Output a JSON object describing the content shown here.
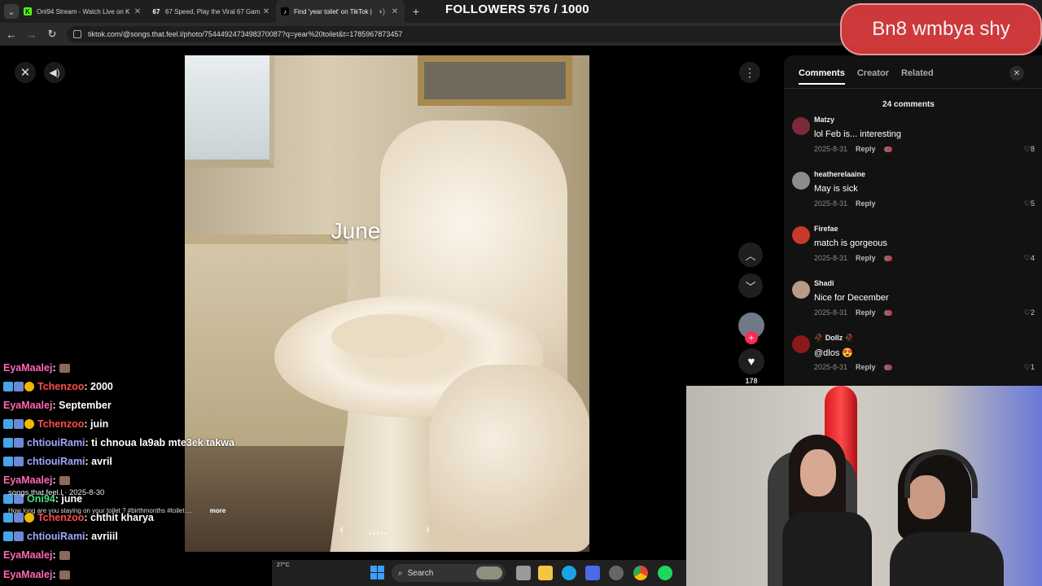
{
  "browser": {
    "tabs": [
      {
        "title": "Oni94 Stream - Watch Live on K",
        "favicon": "K",
        "active": false
      },
      {
        "title": "67 Speed, Play the Viral 67 Gam",
        "favicon": "67",
        "active": false
      },
      {
        "title": "Find 'year toilet' on TikTok |",
        "favicon": "♪",
        "active": true
      }
    ],
    "url": "tiktok.com/@songs.that.feel.l/photo/7544492473498370087?q=year%20toilet&t=1785967873457"
  },
  "overlay": {
    "followers": "FOLLOWERS 576 / 1000",
    "badge": "Bn8 wmbya shy"
  },
  "viewer": {
    "caption_word": "June",
    "like_count": "178",
    "author_line": "songs.that.feel.l · 2025-8-30",
    "description": "How long are you staying on your toilet ? #birthmonths #toilet ...",
    "more_label": "more"
  },
  "comments_panel": {
    "tabs": [
      "Comments",
      "Creator",
      "Related"
    ],
    "count_label": "24 comments",
    "reply_label": "Reply",
    "comments": [
      {
        "user": "Matzy",
        "text": "lol Feb is... interesting",
        "date": "2025-8-31",
        "likes": "8",
        "avatar_color": "#7a2a3a"
      },
      {
        "user": "heatherelaaine",
        "text": "May is sick",
        "date": "2025-8-31",
        "likes": "5",
        "avatar_color": "#8c8c8c"
      },
      {
        "user": "Firefae",
        "text": "match is gorgeous",
        "date": "2025-8-31",
        "likes": "4",
        "avatar_color": "#c83a2a"
      },
      {
        "user": "Shadi",
        "text": "Nice for December",
        "date": "2025-8-31",
        "likes": "2",
        "avatar_color": "#b89a86"
      },
      {
        "user": "🥀 Dollz 🥀",
        "text": "@dlos 😍",
        "date": "2025-8-31",
        "likes": "1",
        "avatar_color": "#8a1a1a"
      }
    ]
  },
  "chat": [
    {
      "user": "EyaMaalej",
      "color": "#ff69b4",
      "badges": 0,
      "msg": " : ",
      "emote": true
    },
    {
      "user": "Tchenzoo",
      "color": "#ff4d4d",
      "badges": 3,
      "msg": " : 2000",
      "emote": false
    },
    {
      "user": "EyaMaalej",
      "color": "#ff69b4",
      "badges": 0,
      "msg": " : September",
      "emote": false
    },
    {
      "user": "Tchenzoo",
      "color": "#ff4d4d",
      "badges": 3,
      "msg": " : juin",
      "emote": false
    },
    {
      "user": "chtiouiRami",
      "color": "#9fa8ff",
      "badges": 2,
      "msg": " : ti chnoua la9ab mte3ek takwa",
      "emote": false
    },
    {
      "user": "chtiouiRami",
      "color": "#9fa8ff",
      "badges": 2,
      "msg": " : avril",
      "emote": false
    },
    {
      "user": "EyaMaalej",
      "color": "#ff69b4",
      "badges": 0,
      "msg": " : ",
      "emote": true
    },
    {
      "user": "Oni94",
      "color": "#4ade80",
      "badges": 2,
      "msg": " : june",
      "emote": false
    },
    {
      "user": "Tchenzoo",
      "color": "#ff4d4d",
      "badges": 3,
      "msg": " : chthit kharya",
      "emote": false
    },
    {
      "user": "chtiouiRami",
      "color": "#9fa8ff",
      "badges": 2,
      "msg": " : avriiil",
      "emote": false
    },
    {
      "user": "EyaMaalej",
      "color": "#ff69b4",
      "badges": 0,
      "msg": " : ",
      "emote": true
    },
    {
      "user": "EyaMaalej",
      "color": "#ff69b4",
      "badges": 0,
      "msg": " : ",
      "emote": true
    }
  ],
  "taskbar": {
    "weather": "27°C",
    "search_label": "Search"
  }
}
